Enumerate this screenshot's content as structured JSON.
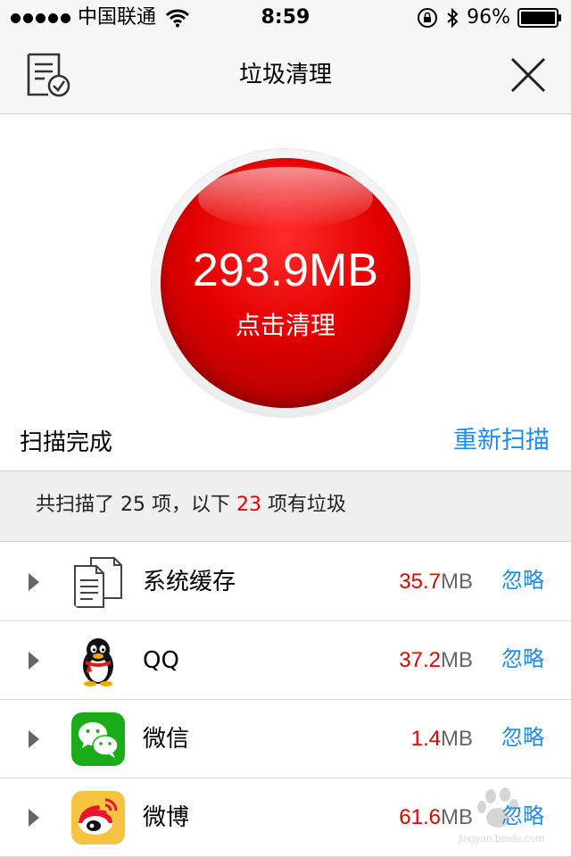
{
  "status_bar": {
    "carrier": "中国联通",
    "time": "8:59",
    "battery": "96%",
    "icons": [
      "signal-dots-icon",
      "wifi-icon",
      "orientation-lock-icon",
      "bluetooth-icon",
      "battery-icon"
    ]
  },
  "nav": {
    "title": "垃圾清理",
    "left_icon": "checklist-icon",
    "right_icon": "close-icon"
  },
  "clean": {
    "size": "293.9MB",
    "label": "点击清理",
    "color": "#e00000"
  },
  "scan": {
    "status": "扫描完成",
    "rescan": "重新扫描"
  },
  "summary": {
    "prefix": "共扫描了 25 项，以下 ",
    "count": "23",
    "suffix": " 项有垃圾"
  },
  "items": [
    {
      "name": "系统缓存",
      "size": "35.7",
      "unit": "MB",
      "ignore": "忽略",
      "icon": "documents-icon"
    },
    {
      "name": "QQ",
      "size": "37.2",
      "unit": "MB",
      "ignore": "忽略",
      "icon": "qq-penguin-icon"
    },
    {
      "name": "微信",
      "size": "1.4",
      "unit": "MB",
      "ignore": "忽略",
      "icon": "wechat-icon"
    },
    {
      "name": "微博",
      "size": "61.6",
      "unit": "MB",
      "ignore": "忽略",
      "icon": "weibo-icon"
    }
  ],
  "watermark": {
    "text": "jingyan.baidu.com"
  },
  "colors": {
    "accent_blue": "#1a8cf0",
    "value_red": "#e60000",
    "wechat_green": "#1aad19",
    "weibo_yellow": "#f5c242"
  }
}
